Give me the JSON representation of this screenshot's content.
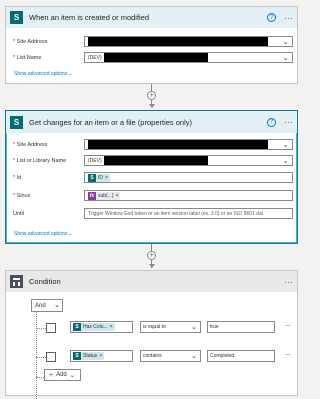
{
  "trigger": {
    "title": "When an item is created or modified",
    "icon": "S",
    "fields": {
      "site_address": {
        "label": "Site Address",
        "required": "*"
      },
      "list_name": {
        "label": "List Name",
        "required": "*",
        "prefix": "(DEV)"
      }
    },
    "advanced_link": "Show advanced options"
  },
  "action": {
    "title": "Get changes for an item or a file (properties only)",
    "icon": "S",
    "fields": {
      "site_address": {
        "label": "Site Address",
        "required": "*"
      },
      "list_name": {
        "label": "List or Library Name",
        "required": "*",
        "prefix": "(DEV)"
      },
      "id": {
        "label": "Id",
        "required": "*",
        "token": "ID",
        "token_icon": "S"
      },
      "since": {
        "label": "Since",
        "required": "*",
        "token": "sub(...)",
        "token_icon": "fx"
      },
      "until": {
        "label": "Until",
        "placeholder": "Trigger Window End token or an item version label (ex. 3.0) or an ISO 8601 dat"
      }
    },
    "advanced_link": "Show advanced options"
  },
  "condition": {
    "title": "Condition",
    "group_operator": "And",
    "rows": [
      {
        "token": "Has Colu...",
        "operator": "is equal to",
        "value": "true"
      },
      {
        "token": "Status",
        "operator": "contains",
        "value": "Completed"
      }
    ],
    "add_label": "Add"
  },
  "icons": {
    "help": "help-icon",
    "more": "more-icon",
    "chevron": "chevron-down-icon",
    "add_step": "plus-icon"
  },
  "colors": {
    "sharepoint": "#036c70",
    "accent": "#0078d4",
    "function": "#8b3aa8"
  }
}
